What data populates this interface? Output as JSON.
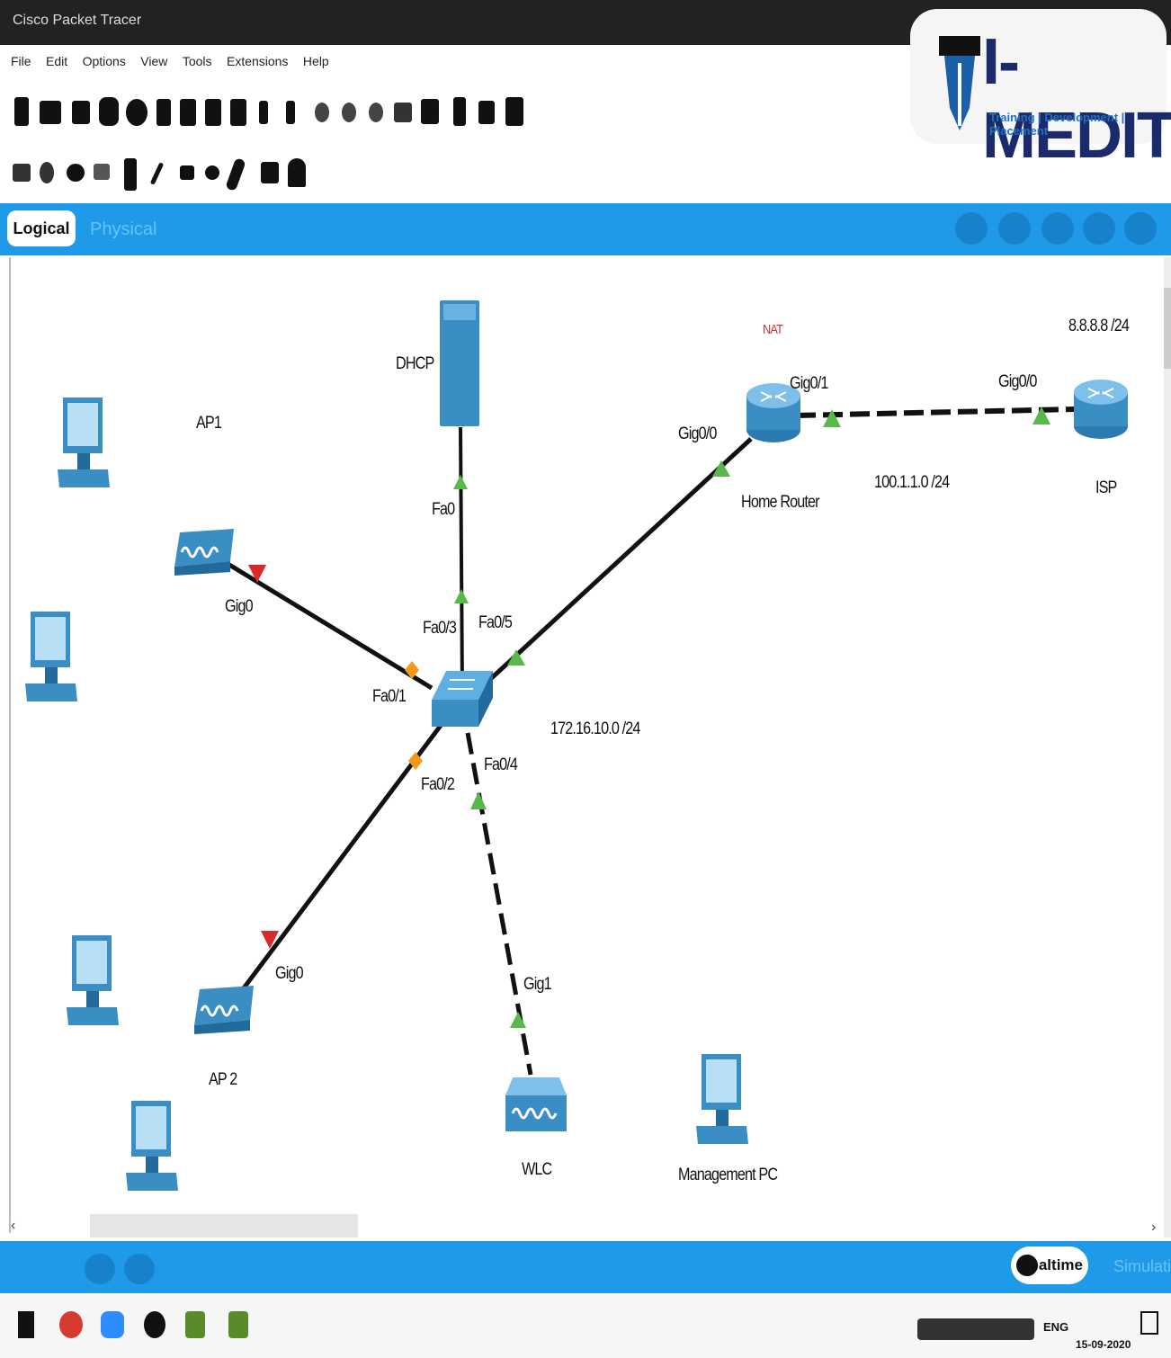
{
  "window": {
    "title": "Cisco Packet Tracer"
  },
  "menu": [
    "File",
    "Edit",
    "Options",
    "View",
    "Tools",
    "Extensions",
    "Help"
  ],
  "logo": {
    "brand": "I-MEDITA",
    "tagline": "Training | Development | Placement"
  },
  "modebar": {
    "logical_tab": "Logical",
    "physical_tab": "Physical"
  },
  "devices": {
    "dhcp": "DHCP",
    "ap1": "AP1",
    "ap2": "AP 2",
    "home_router": "Home Router",
    "isp": "ISP",
    "wlc": "WLC",
    "management_pc": "Management PC",
    "switch": ""
  },
  "annotations": {
    "nat": "NAT",
    "isp_net": "8.8.8.8 /24",
    "wan_net": "100.1.1.0 /24",
    "lan_net": "172.16.10.0 /24"
  },
  "ports": {
    "router_gig01": "Gig0/1",
    "isp_gig00": "Gig0/0",
    "router_gig00": "Gig0/0",
    "dhcp_fa0": "Fa0",
    "sw_fa03": "Fa0/3",
    "sw_fa05": "Fa0/5",
    "ap1_gig0": "Gig0",
    "sw_fa01": "Fa0/1",
    "sw_fa02": "Fa0/2",
    "sw_fa04": "Fa0/4",
    "ap2_gig0": "Gig0",
    "wlc_gig1": "Gig1"
  },
  "bottombar": {
    "realtime": "Realtime",
    "simulation": "Simulation"
  },
  "taskbar": {
    "language": "ENG",
    "date": "15-09-2020"
  },
  "colors": {
    "accent": "#1e9ae8",
    "link_up": "#59b84a",
    "link_down": "#d82a2a",
    "link_orange": "#f39a1a",
    "device": "#3a8ec4"
  }
}
